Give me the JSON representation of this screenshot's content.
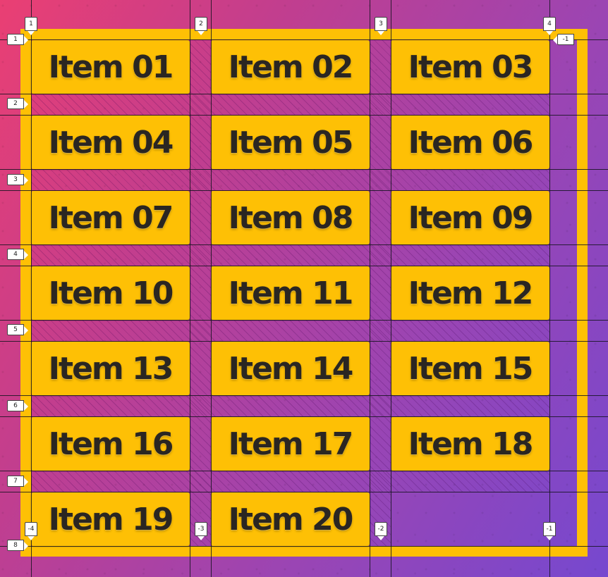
{
  "items": [
    "Item 01",
    "Item 02",
    "Item 03",
    "Item 04",
    "Item 05",
    "Item 06",
    "Item 07",
    "Item 08",
    "Item 09",
    "Item 10",
    "Item 11",
    "Item 12",
    "Item 13",
    "Item 14",
    "Item 15",
    "Item 16",
    "Item 17",
    "Item 18",
    "Item 19",
    "Item 20"
  ],
  "grid_overlay": {
    "column_badges_top": [
      "1",
      "2",
      "3",
      "4"
    ],
    "column_badges_bottom": [
      "-4",
      "-3",
      "-2",
      "-1"
    ],
    "row_badges": [
      "1",
      "2",
      "3",
      "4",
      "5",
      "6",
      "7",
      "8"
    ],
    "row_badge_right": "-1"
  },
  "colors": {
    "item_background": "#fec005",
    "item_text": "#2a2622",
    "background_gradient_start": "#ea3f73",
    "background_gradient_end": "#7648cf",
    "grid_line": "#14141e"
  }
}
